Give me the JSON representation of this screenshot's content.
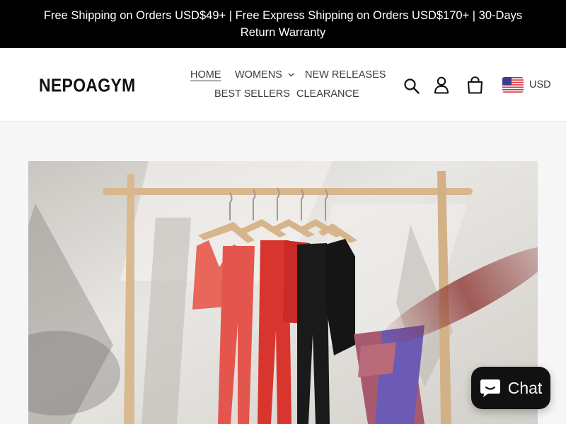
{
  "announcement": {
    "text": "Free Shipping on Orders USD$49+ | Free Express Shipping on Orders USD$170+ | 30-Days Return Warranty"
  },
  "header": {
    "logo": "NEPOAGYM",
    "nav": {
      "home": "HOME",
      "womens": "WOMENS",
      "new_releases": "NEW RELEASES",
      "best_sellers": "BEST SELLERS",
      "clearance": "CLEARANCE"
    },
    "icons": [
      "search-icon",
      "account-icon",
      "cart-icon"
    ],
    "currency": {
      "code": "USD",
      "flag": "us-flag-icon"
    }
  },
  "hero": {
    "image": "clothing-rack-activewear"
  },
  "chat": {
    "label": "Chat",
    "icon": "chat-bubble-icon"
  },
  "colors": {
    "announcement_bg": "#000000",
    "chat_bg": "#111111",
    "page_bg": "#f6f6f6"
  }
}
